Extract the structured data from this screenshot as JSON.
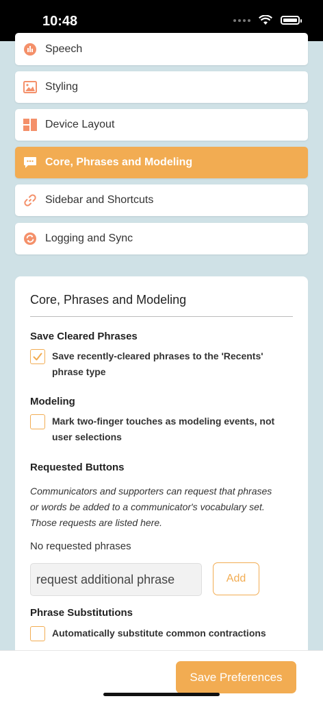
{
  "status": {
    "time": "10:48"
  },
  "menu": {
    "items": [
      {
        "label": "Speech",
        "icon": "speech-icon"
      },
      {
        "label": "Styling",
        "icon": "image-icon"
      },
      {
        "label": "Device Layout",
        "icon": "layout-icon"
      },
      {
        "label": "Core, Phrases and Modeling",
        "icon": "chat-icon",
        "active": true
      },
      {
        "label": "Sidebar and Shortcuts",
        "icon": "link-icon"
      },
      {
        "label": "Logging and Sync",
        "icon": "sync-icon"
      }
    ]
  },
  "panel": {
    "title": "Core, Phrases and Modeling",
    "save_cleared": {
      "heading": "Save Cleared Phrases",
      "checkbox_label": "Save recently-cleared phrases to the 'Recents' phrase type",
      "checked": true
    },
    "modeling": {
      "heading": "Modeling",
      "checkbox_label": "Mark two-finger touches as modeling events, not user selections",
      "checked": false
    },
    "requested": {
      "heading": "Requested Buttons",
      "description": "Communicators and supporters can request that phrases or words be added to a communicator's vocabulary set. Those requests are listed here.",
      "empty_text": "No requested phrases",
      "input_placeholder": "request additional phrase",
      "add_label": "Add"
    },
    "substitutions": {
      "heading": "Phrase Substitutions",
      "checkbox_label": "Automatically substitute common contractions",
      "checked": false
    }
  },
  "footer": {
    "save_label": "Save Preferences"
  },
  "colors": {
    "accent": "#f2ac52",
    "background": "#cfe1e6",
    "icon": "#f4906a"
  }
}
